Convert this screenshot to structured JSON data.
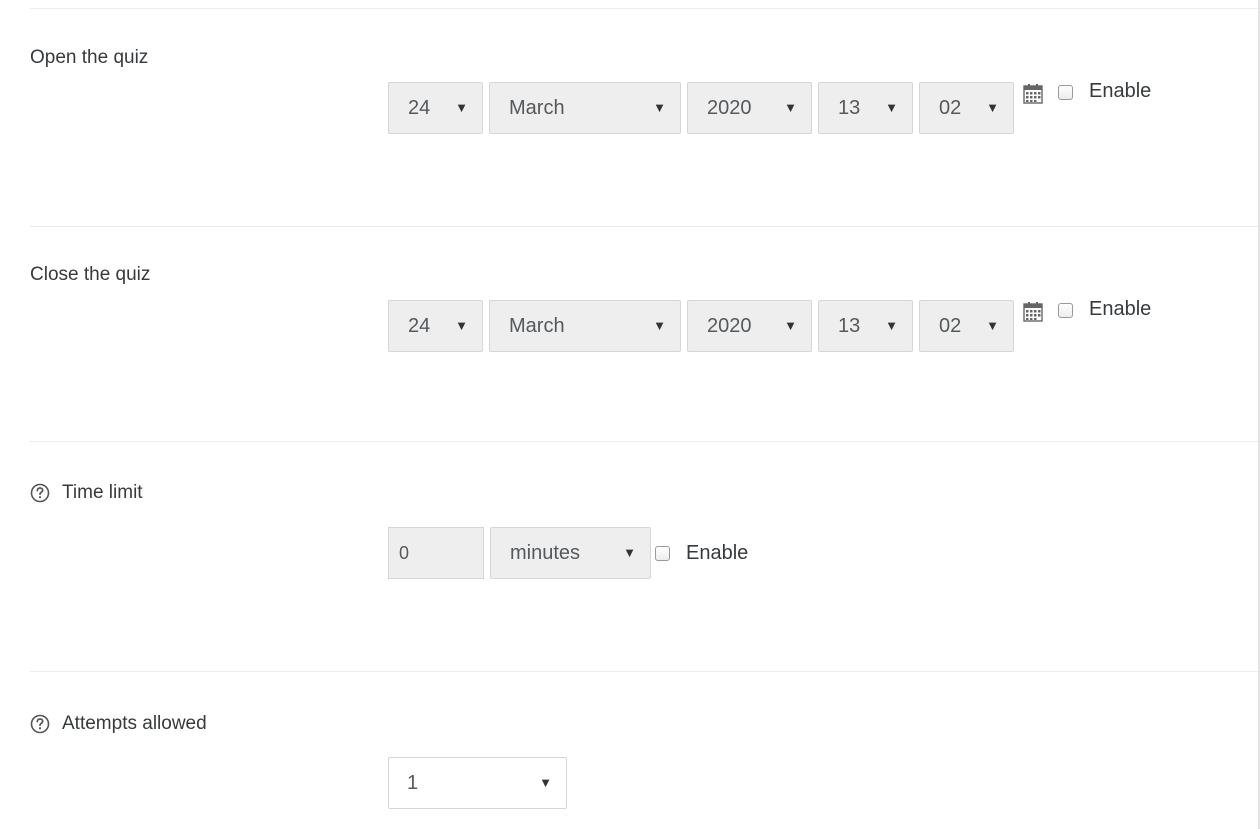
{
  "open_quiz": {
    "label": "Open the quiz",
    "day": "24",
    "month": "March",
    "year": "2020",
    "hour": "13",
    "minute": "02",
    "enable_label": "Enable"
  },
  "close_quiz": {
    "label": "Close the quiz",
    "day": "24",
    "month": "March",
    "year": "2020",
    "hour": "13",
    "minute": "02",
    "enable_label": "Enable"
  },
  "time_limit": {
    "label": "Time limit",
    "value": "0",
    "unit": "minutes",
    "enable_label": "Enable"
  },
  "attempts": {
    "label": "Attempts allowed",
    "value": "1"
  },
  "icons": {
    "help": "help-circle-icon",
    "calendar": "calendar-icon",
    "dropdown": "caret-down-icon"
  },
  "colors": {
    "select_bg": "#eeeeee",
    "border": "#d6d6d6",
    "text": "#373a3c",
    "divider": "#ececec"
  }
}
